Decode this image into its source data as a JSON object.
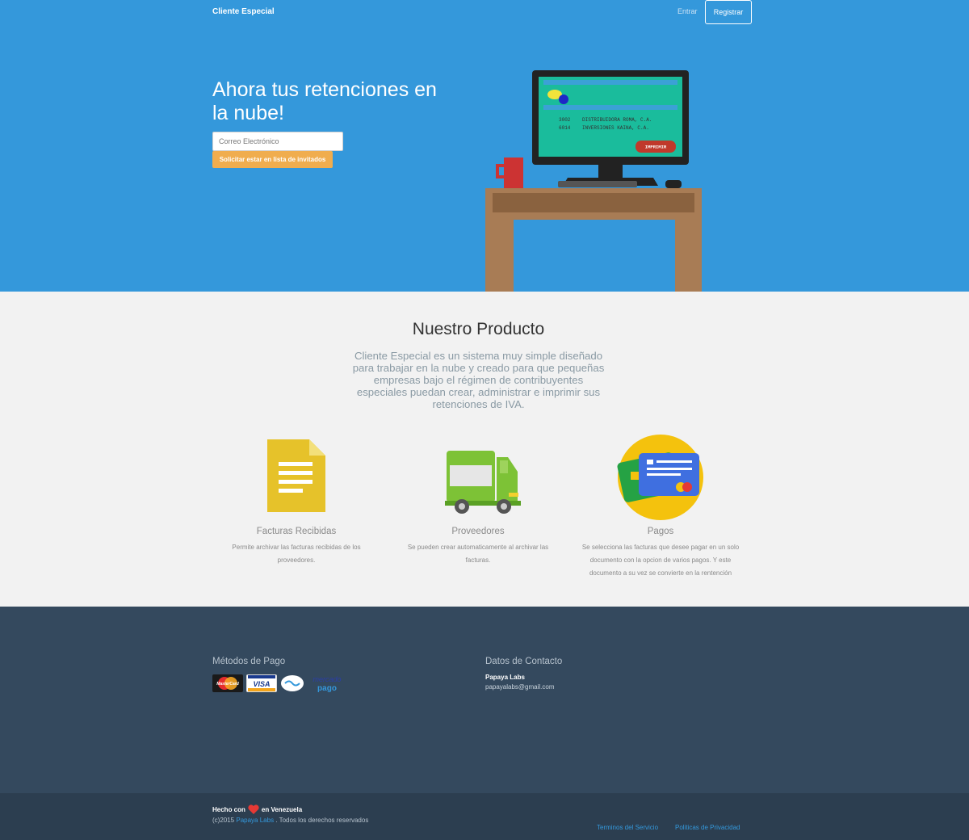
{
  "navbar": {
    "brand": "Cliente Especial",
    "login_label": "Entrar",
    "register_label": "Registrar"
  },
  "hero": {
    "title": "Ahora tus retenciones en la nube!",
    "email_placeholder": "Correo Electrónico",
    "invite_button_label": "Solicitar estar en lista de invitados",
    "screen_rows": [
      {
        "code": "3002",
        "name": "DISTRIBUIDORA ROMA, C.A."
      },
      {
        "code": "6014",
        "name": "INVERSIONES KAINA, C.A."
      }
    ],
    "screen_button_label": "IMPRIMIR"
  },
  "product": {
    "title": "Nuestro Producto",
    "description": "Cliente Especial es un sistema muy simple diseñado para trabajar en la nube y creado para que pequeñas empresas bajo el régimen de contribuyentes especiales puedan crear, administrar e imprimir sus retenciones de IVA.",
    "features": [
      {
        "icon": "document-icon",
        "title": "Facturas Recibidas",
        "description": "Permite archivar las facturas recibidas de los proveedores."
      },
      {
        "icon": "truck-icon",
        "title": "Proveedores",
        "description": "Se pueden crear automaticamente al archivar las facturas."
      },
      {
        "icon": "credit-cards-icon",
        "title": "Pagos",
        "description": "Se selecciona las facturas que desee pagar en un solo documento con la opcion de varios pagos. Y este documento a su vez se convierte en la rentención"
      }
    ]
  },
  "footer": {
    "payment_heading": "Métodos de Pago",
    "payment_methods": [
      "MasterCard",
      "VISA",
      "mercado pago"
    ],
    "contact_heading": "Datos de Contacto",
    "contact_name": "Papaya Labs",
    "contact_email": "papayalabs@gmail.com"
  },
  "bottom": {
    "made_with_prefix": "Hecho con",
    "made_with_suffix": "en Venezuela",
    "copyright_prefix": "(c)2015",
    "copyright_link": "Papaya Labs",
    "copyright_suffix": ". Todos los derechos reservados",
    "terms_label": "Terminos del Servicio",
    "privacy_label": "Politicas de Privacidad"
  },
  "colors": {
    "hero_bg": "#3498db",
    "accent_orange": "#f0ad4e",
    "footer_bg": "#34495e",
    "bottom_bg": "#2c3e50"
  }
}
